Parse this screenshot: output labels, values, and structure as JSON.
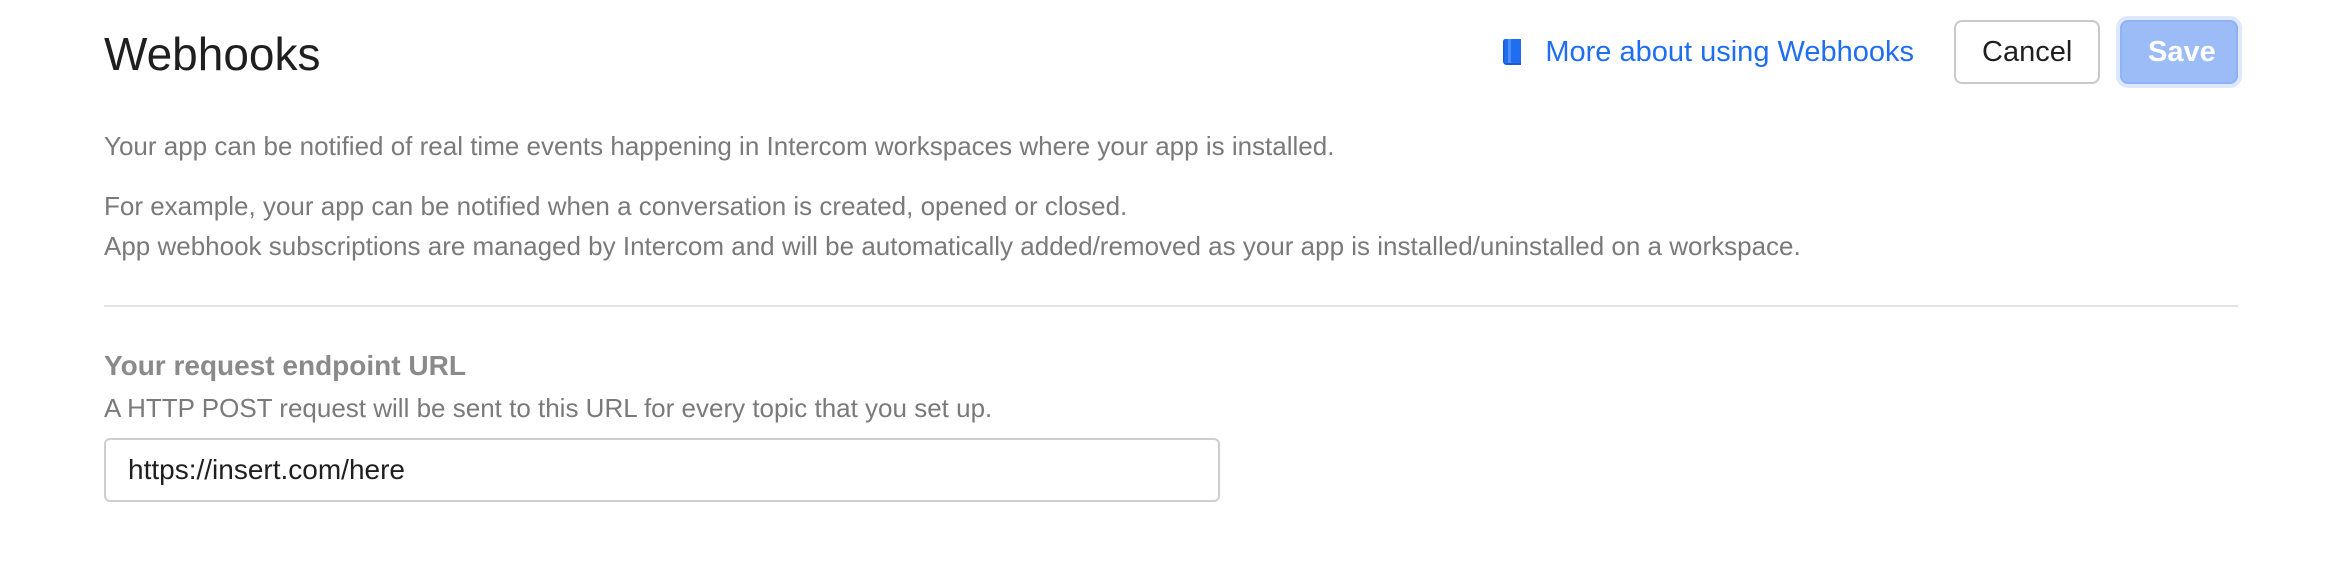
{
  "header": {
    "title": "Webhooks",
    "help_link_label": "More about using Webhooks",
    "help_link_icon": "book-icon",
    "cancel_label": "Cancel",
    "save_label": "Save"
  },
  "description": {
    "line1": "Your app can be notified of real time events happening in Intercom workspaces where your app is installed.",
    "line2": "For example, your app can be notified when a conversation is created, opened or closed.",
    "line3": "App webhook subscriptions are managed by Intercom and will be automatically added/removed as your app is installed/uninstalled on a workspace."
  },
  "endpoint": {
    "label": "Your request endpoint URL",
    "help": "A HTTP POST request will be sent to this URL for every topic that you set up.",
    "value": "https://insert.com/here"
  },
  "colors": {
    "link": "#1f6ef2",
    "save_disabled": "#9cbcf7",
    "muted_text": "#7a7a7a"
  }
}
